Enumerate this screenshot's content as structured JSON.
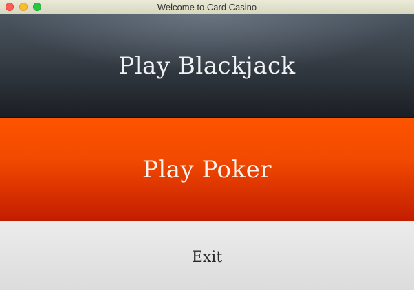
{
  "window": {
    "title": "Welcome to Card Casino"
  },
  "buttons": {
    "blackjack_label": "Play Blackjack",
    "poker_label": "Play Poker",
    "exit_label": "Exit"
  },
  "colors": {
    "blackjack_top": "#4b5560",
    "blackjack_bottom": "#1b1f24",
    "poker_top": "#fd5400",
    "poker_bottom": "#c31d00",
    "exit_bg": "#e6e6e6"
  }
}
